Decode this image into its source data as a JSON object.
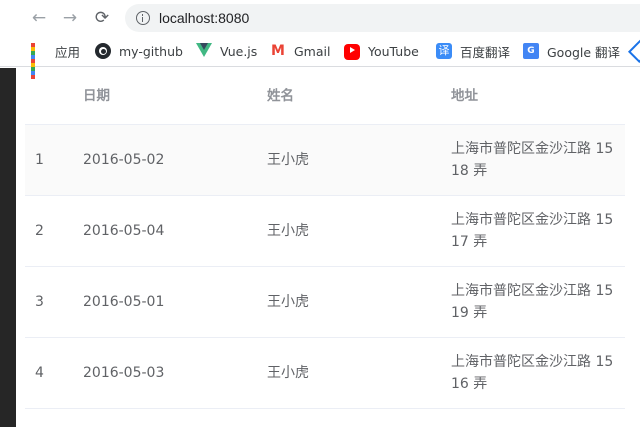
{
  "browser": {
    "url": "localhost:8080",
    "bookmarks": [
      {
        "label": "应用",
        "icon": "apps-grid-icon"
      },
      {
        "label": "my-github",
        "icon": "github-icon"
      },
      {
        "label": "Vue.js",
        "icon": "vue-icon"
      },
      {
        "label": "Gmail",
        "icon": "gmail-icon"
      },
      {
        "label": "YouTube",
        "icon": "youtube-icon"
      },
      {
        "label": "百度翻译",
        "icon": "baidu-translate-icon"
      },
      {
        "label": "Google 翻译",
        "icon": "google-translate-icon"
      }
    ],
    "icons": {
      "back": "←",
      "forward": "→",
      "reload": "⟳",
      "baidu": "译",
      "gmail": "M"
    }
  },
  "table": {
    "headers": {
      "index": "",
      "date": "日期",
      "name": "姓名",
      "address": "地址"
    },
    "rows": [
      {
        "index": "1",
        "date": "2016-05-02",
        "name": "王小虎",
        "address": "上海市普陀区金沙江路 1518 弄"
      },
      {
        "index": "2",
        "date": "2016-05-04",
        "name": "王小虎",
        "address": "上海市普陀区金沙江路 1517 弄"
      },
      {
        "index": "3",
        "date": "2016-05-01",
        "name": "王小虎",
        "address": "上海市普陀区金沙江路 1519 弄"
      },
      {
        "index": "4",
        "date": "2016-05-03",
        "name": "王小虎",
        "address": "上海市普陀区金沙江路 1516 弄"
      }
    ]
  },
  "colors": {
    "text": "#606266",
    "header_text": "#909399",
    "border": "#ebeef5",
    "stripe": "#fafafa"
  }
}
